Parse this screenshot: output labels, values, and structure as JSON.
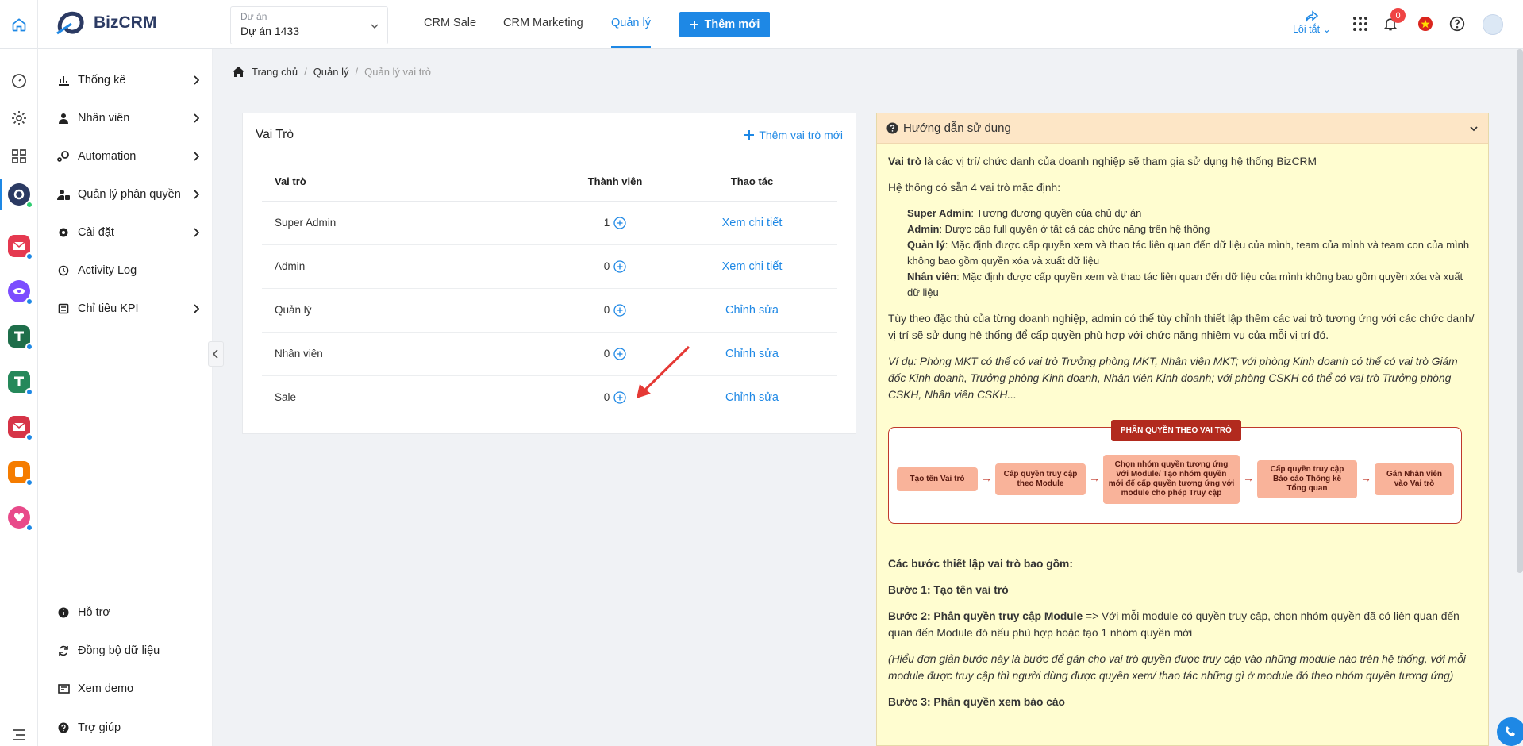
{
  "header": {
    "brand": "BizCRM",
    "project_label": "Dự án",
    "project_value": "Dự án 1433",
    "nav": [
      "CRM Sale",
      "CRM Marketing",
      "Quản lý"
    ],
    "add_button": "Thêm mới",
    "shortcut_label": "Lối tắt",
    "notification_count": "0"
  },
  "sidebar": {
    "items": [
      {
        "label": "Thống kê",
        "icon": "bar-chart-icon"
      },
      {
        "label": "Nhân viên",
        "icon": "user-icon"
      },
      {
        "label": "Automation",
        "icon": "automation-icon"
      },
      {
        "label": "Quản lý phân quyền",
        "icon": "user-lock-icon"
      },
      {
        "label": "Cài đặt",
        "icon": "gear-icon"
      },
      {
        "label": "Activity Log",
        "icon": "history-icon"
      },
      {
        "label": "Chỉ tiêu KPI",
        "icon": "list-icon"
      }
    ],
    "bottom": [
      {
        "label": "Hỗ trợ",
        "icon": "info-icon"
      },
      {
        "label": "Đồng bộ dữ liệu",
        "icon": "sync-icon"
      },
      {
        "label": "Xem demo",
        "icon": "demo-icon"
      },
      {
        "label": "Trợ giúp",
        "icon": "help-icon"
      }
    ]
  },
  "breadcrumb": [
    "Trang chủ",
    "Quản lý",
    "Quản lý vai trò"
  ],
  "roles": {
    "title": "Vai Trò",
    "add_label": "Thêm vai trò mới",
    "columns": [
      "Vai trò",
      "Thành viên",
      "Thao tác"
    ],
    "rows": [
      {
        "name": "Super Admin",
        "count": "1",
        "action": "Xem chi tiết"
      },
      {
        "name": "Admin",
        "count": "0",
        "action": "Xem chi tiết"
      },
      {
        "name": "Quản lý",
        "count": "0",
        "action": "Chỉnh sửa"
      },
      {
        "name": "Nhân viên",
        "count": "0",
        "action": "Chỉnh sửa"
      },
      {
        "name": "Sale",
        "count": "0",
        "action": "Chỉnh sửa"
      }
    ]
  },
  "guide": {
    "title": "Hướng dẫn sử dụng",
    "intro_bold": "Vai trò",
    "intro_rest": " là các vị trí/ chức danh của doanh nghiệp sẽ tham gia sử dụng hệ thống BizCRM",
    "default_roles": "Hệ thống có sẵn 4 vai trò mặc định:",
    "role_list": [
      {
        "name": "Super Admin",
        "desc": ": Tương đương quyền của chủ dự án"
      },
      {
        "name": "Admin",
        "desc": ": Được cấp full quyền ở tất cả các chức năng trên hệ thống"
      },
      {
        "name": "Quản lý",
        "desc": ": Mặc định được cấp quyền xem và thao tác liên quan đến dữ liệu của mình, team của mình và team con của mình không bao gồm quyền xóa và xuất dữ liệu"
      },
      {
        "name": "Nhân viên",
        "desc": ": Mặc định được cấp quyền xem và thao tác liên quan đến dữ liệu của mình không bao gồm quyền xóa và xuất dữ liệu"
      }
    ],
    "custom": "Tùy theo đặc thù của từng doanh nghiệp, admin có thể tùy chỉnh thiết lập thêm các vai trò tương ứng với các chức danh/ vị trí sẽ sử dụng hệ thống để cấp quyền phù hợp với chức năng nhiệm vụ của mỗi vị trí đó.",
    "example": "Ví dụ: Phòng MKT có thể có vai trò Trưởng phòng MKT, Nhân viên MKT; với phòng Kinh doanh có thể có vai trò Giám đốc Kinh doanh, Trưởng phòng Kinh doanh, Nhân viên Kinh doanh; với phòng CSKH có thể có vai trò Trưởng phòng CSKH, Nhân viên CSKH...",
    "diagram_title": "PHÂN QUYỀN THEO VAI TRÒ",
    "diagram_steps": [
      "Tạo tên Vai trò",
      "Cấp quyền truy cập theo Module",
      "Chọn nhóm quyền tương ứng với Module/ Tạo nhóm quyền mới để cấp quyền tương ứng với module cho phép Truy cập",
      "Cấp quyền truy cập Báo cáo Thống kê Tổng quan",
      "Gán Nhân viên vào Vai trò"
    ],
    "steps_heading": "Các bước thiết lập vai trò bao gồm:",
    "step1": "Bước 1: Tạo tên vai trò",
    "step2_bold": "Bước 2: Phân quyền truy cập Module",
    "step2_rest": " => Với mỗi module có quyền truy cập, chọn nhóm quyền đã có liên quan đến quan đến Module đó nếu phù hợp hoặc tạo 1 nhóm quyền mới",
    "step2_note": "(Hiểu đơn giản bước này là bước để gán cho vai trò quyền được truy cập vào những module nào trên hệ thống, với mỗi module được truy cập thì người dùng được quyền xem/ thao tác những gì ở module đó theo nhóm quyền tương ứng)",
    "step3": "Bước 3: Phân quyền xem báo cáo"
  },
  "colors": {
    "primary": "#1e88e5",
    "arrow": "#e53935",
    "guide_bg": "#fffdd0",
    "guide_head": "#fde6c6",
    "diagram_red": "#c0392b"
  }
}
